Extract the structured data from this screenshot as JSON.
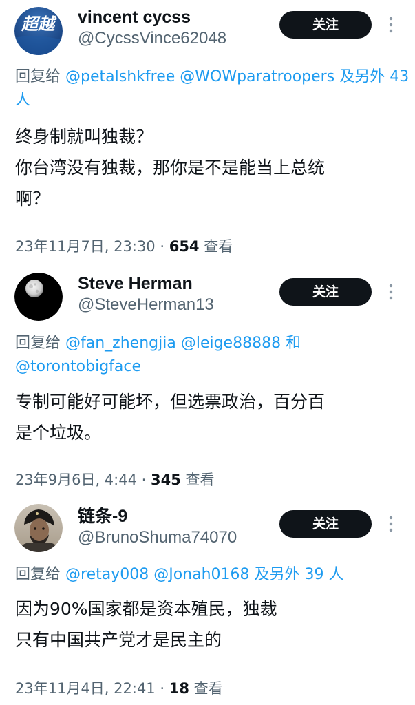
{
  "posts": [
    {
      "avatar_text": "超越",
      "display_name": "vincent cycss",
      "handle": "@CycssVince62048",
      "follow_label": "关注",
      "more_icon": "ellipsis-vertical-icon",
      "reply_prefix": "回复给",
      "mentions": [
        "@petalshkfree",
        "@WOWparatroopers",
        "及另外",
        "43 人"
      ],
      "body_lines": [
        "终身制就叫独裁？",
        "你台湾没有独裁，那你是不是能当上总统",
        "啊？"
      ],
      "datetime": "23年11月7日, 23:30 · ",
      "views_count": "654",
      "views_label": " 查看"
    },
    {
      "avatar_text": "",
      "display_name": "Steve Herman",
      "handle": "@SteveHerman13",
      "follow_label": "关注",
      "more_icon": "ellipsis-vertical-icon",
      "reply_prefix": "回复给",
      "mentions": [
        "@fan_zhengjia",
        "@leige88888",
        "和",
        "@torontobigface"
      ],
      "body_lines": [
        "专制可能好可能坏，但选票政治，百分百",
        "是个垃圾。"
      ],
      "datetime": "23年9月6日, 4:44 · ",
      "views_count": "345",
      "views_label": " 查看"
    },
    {
      "avatar_text": "",
      "display_name": "链条-9",
      "handle": "@BrunoShuma74070",
      "follow_label": "关注",
      "more_icon": "ellipsis-vertical-icon",
      "reply_prefix": "回复给",
      "mentions": [
        "@retay008",
        "@Jonah0168",
        "及另外 39 人"
      ],
      "body_lines": [
        "因为90%国家都是资本殖民，独裁",
        "只有中国共产党才是民主的"
      ],
      "datetime": "23年11月4日, 22:41 · ",
      "views_count": "18",
      "views_label": " 查看"
    }
  ],
  "colors": {
    "text_primary": "#0f1419",
    "text_secondary": "#536471",
    "link": "#1d9bf0",
    "button_bg": "#0f1419",
    "button_text": "#ffffff"
  }
}
